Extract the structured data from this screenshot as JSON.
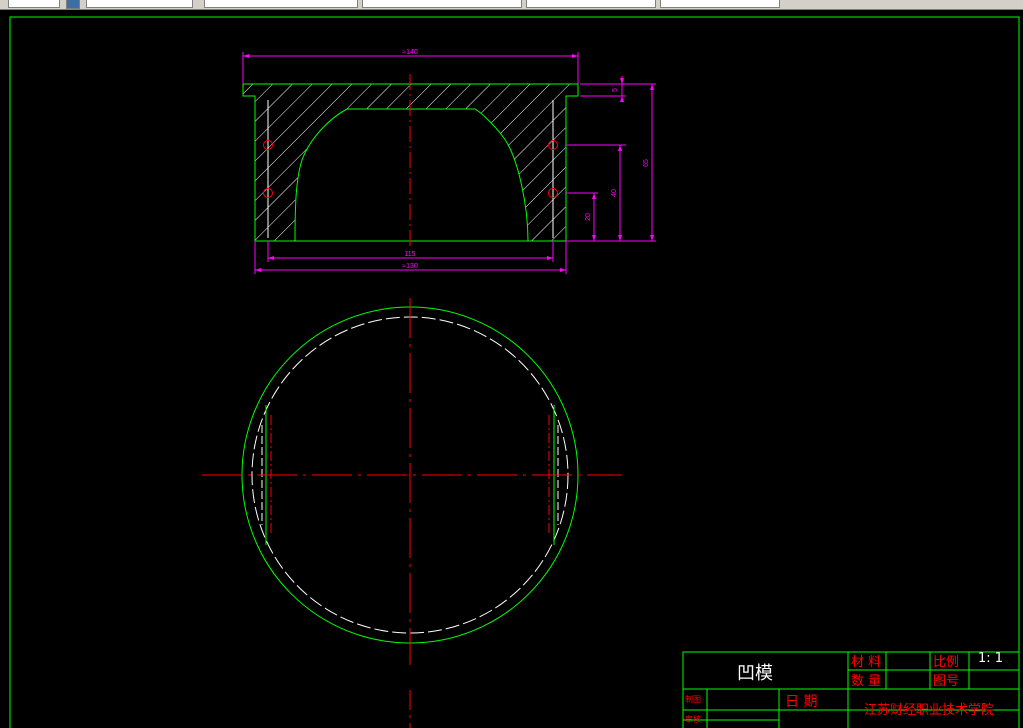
{
  "toolbar": {
    "fields": [
      {
        "name": "layer-combo",
        "value": ""
      },
      {
        "name": "linetype-combo",
        "value": ""
      },
      {
        "name": "lineweight-combo",
        "value": ""
      },
      {
        "name": "plotstyle-combo",
        "value": ""
      },
      {
        "name": "color-combo",
        "value": ""
      }
    ],
    "icons": [
      "layer-properties-icon"
    ]
  },
  "dimensions": {
    "width_top": "≈140",
    "width_mid": "115",
    "width_bottom": "≈130",
    "h_5": "5",
    "h_65": "65",
    "h_40": "40",
    "h_20": "20"
  },
  "title_block": {
    "part_name": "凹模",
    "material_label": "材 料",
    "quantity_label": "数 量",
    "scale_label": "比例",
    "scale_value": "1: 1",
    "drawing_no_label": "图号",
    "drawn_by_label": "制图",
    "checked_by_label": "审核",
    "date_label": "日  期",
    "school": "江苏财经职业技术学院"
  },
  "colors": {
    "background": "#000000",
    "outline": "#00ff00",
    "centerline": "#ff0000",
    "dimension": "#ff00ff",
    "hidden_line": "#ffffff",
    "title_text": "#ff0000"
  }
}
